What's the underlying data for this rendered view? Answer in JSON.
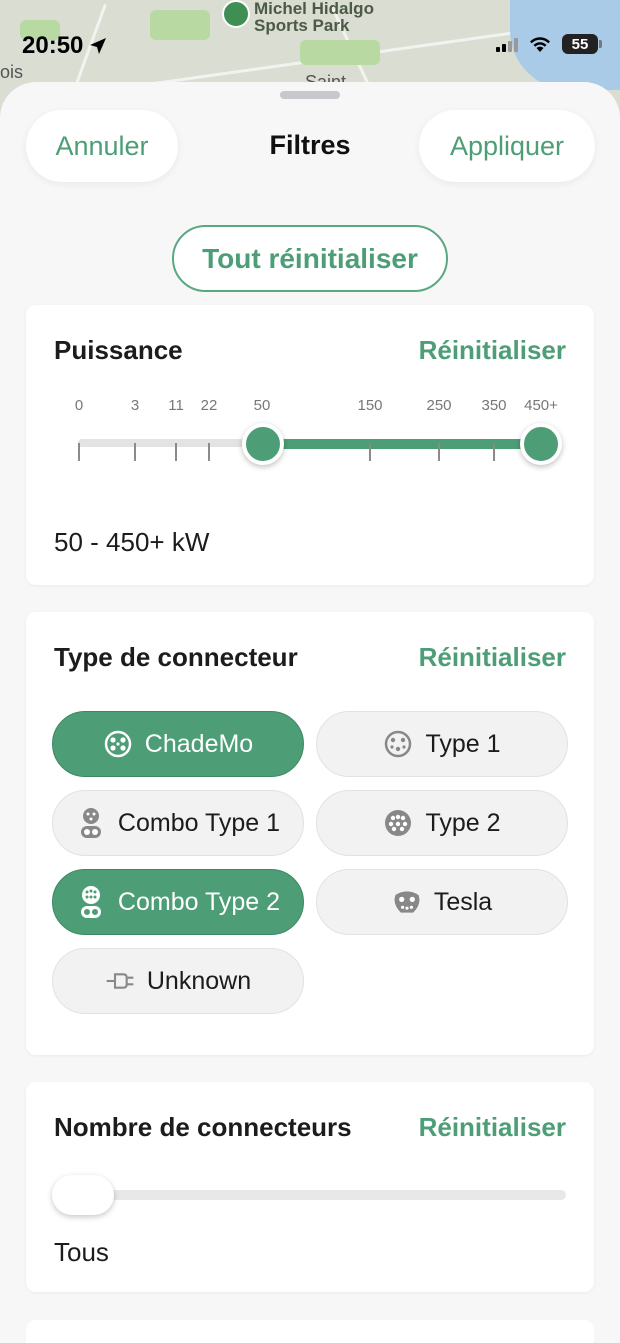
{
  "map": {
    "park_label_line1": "Michel Hidalgo",
    "park_label_line2": "Sports Park",
    "fragment_left": "ois",
    "fragment_center": "Saint"
  },
  "status_bar": {
    "time": "20:50",
    "battery": "55"
  },
  "header": {
    "cancel_label": "Annuler",
    "title": "Filtres",
    "apply_label": "Appliquer"
  },
  "reset_all_label": "Tout réinitialiser",
  "power": {
    "title": "Puissance",
    "reset_label": "Réinitialiser",
    "ticks": [
      "0",
      "3",
      "11",
      "22",
      "50",
      "150",
      "250",
      "350",
      "450+"
    ],
    "selected_min": "50",
    "selected_max": "450+",
    "value_text": "50 - 450+ kW"
  },
  "connector_type": {
    "title": "Type de connecteur",
    "reset_label": "Réinitialiser",
    "options": [
      {
        "label": "ChadeMo",
        "selected": true,
        "icon": "chademo-icon"
      },
      {
        "label": "Type 1",
        "selected": false,
        "icon": "type1-icon"
      },
      {
        "label": "Combo Type 1",
        "selected": false,
        "icon": "combo-type1-icon"
      },
      {
        "label": "Type 2",
        "selected": false,
        "icon": "type2-icon"
      },
      {
        "label": "Combo Type 2",
        "selected": true,
        "icon": "combo-type2-icon"
      },
      {
        "label": "Tesla",
        "selected": false,
        "icon": "tesla-icon"
      },
      {
        "label": "Unknown",
        "selected": false,
        "icon": "unknown-plug-icon"
      }
    ]
  },
  "connector_count": {
    "title": "Nombre de connecteurs",
    "reset_label": "Réinitialiser",
    "value_text": "Tous"
  },
  "colors": {
    "accent": "#4d9e76",
    "sheet_bg": "#f6f7f6",
    "card_bg": "#ffffff"
  }
}
